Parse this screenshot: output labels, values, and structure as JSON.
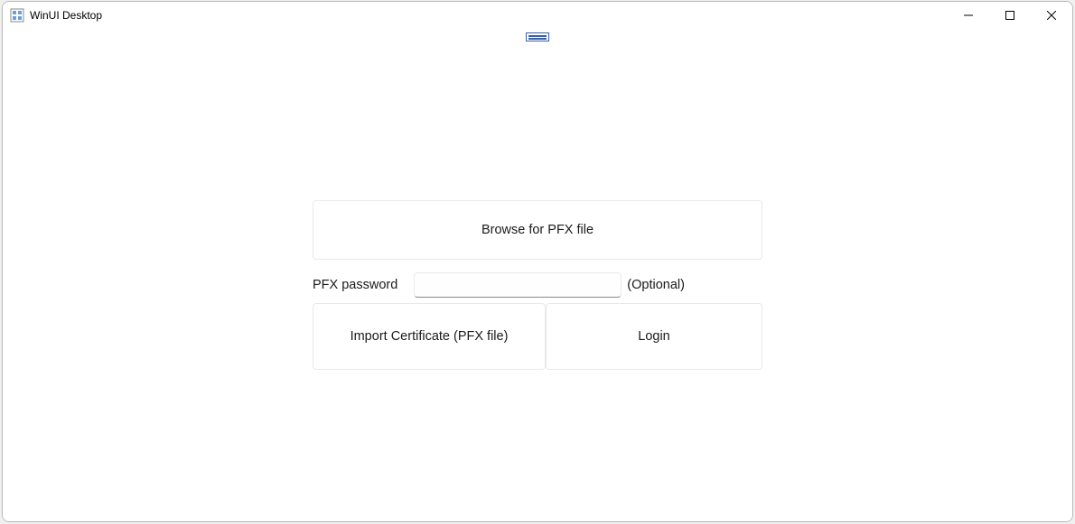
{
  "window": {
    "title": "WinUI Desktop"
  },
  "form": {
    "browse_label": "Browse for PFX file",
    "password_label": "PFX password",
    "password_value": "",
    "optional_label": "(Optional)",
    "import_label": "Import Certificate (PFX file)",
    "login_label": "Login"
  }
}
